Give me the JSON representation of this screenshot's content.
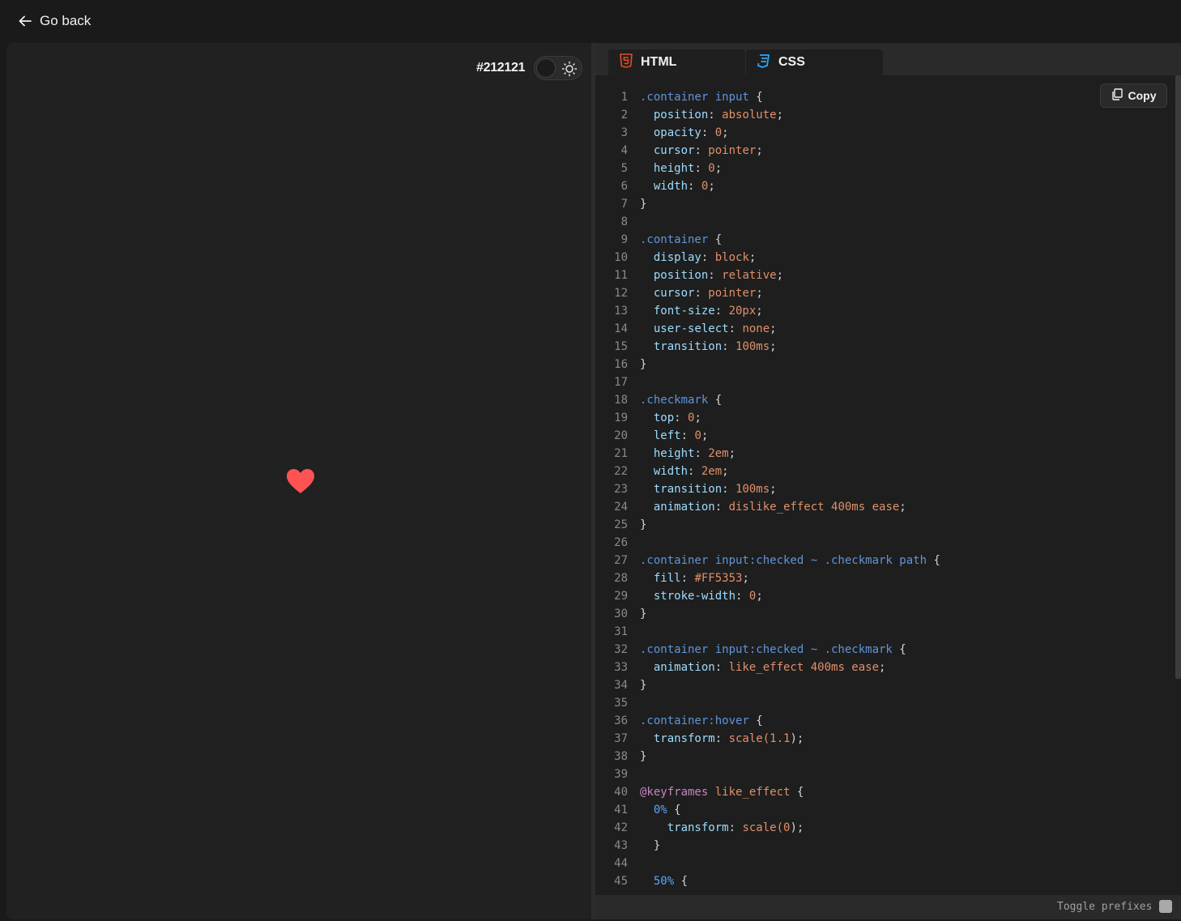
{
  "nav": {
    "back_label": "Go back"
  },
  "preview": {
    "background_hex": "#212121",
    "heart_color": "#FF5353",
    "theme_toggle_icon": "sun-icon"
  },
  "tabs": [
    {
      "label": "HTML",
      "icon": "html5-icon",
      "icon_color": "#e34c26"
    },
    {
      "label": "CSS",
      "icon": "css3-icon",
      "icon_color": "#2aa7ff",
      "active": true
    }
  ],
  "editor": {
    "copy_label": "Copy",
    "toggle_prefixes_label": "Toggle prefixes",
    "code_lines": [
      [
        [
          "sel",
          ".container input"
        ],
        [
          "punc",
          " {"
        ]
      ],
      [
        [
          "punc",
          "  "
        ],
        [
          "prop",
          "position"
        ],
        [
          "punc",
          ": "
        ],
        [
          "val",
          "absolute"
        ],
        [
          "punc",
          ";"
        ]
      ],
      [
        [
          "punc",
          "  "
        ],
        [
          "prop",
          "opacity"
        ],
        [
          "punc",
          ": "
        ],
        [
          "num",
          "0"
        ],
        [
          "punc",
          ";"
        ]
      ],
      [
        [
          "punc",
          "  "
        ],
        [
          "prop",
          "cursor"
        ],
        [
          "punc",
          ": "
        ],
        [
          "val",
          "pointer"
        ],
        [
          "punc",
          ";"
        ]
      ],
      [
        [
          "punc",
          "  "
        ],
        [
          "prop",
          "height"
        ],
        [
          "punc",
          ": "
        ],
        [
          "num",
          "0"
        ],
        [
          "punc",
          ";"
        ]
      ],
      [
        [
          "punc",
          "  "
        ],
        [
          "prop",
          "width"
        ],
        [
          "punc",
          ": "
        ],
        [
          "num",
          "0"
        ],
        [
          "punc",
          ";"
        ]
      ],
      [
        [
          "punc",
          "}"
        ]
      ],
      [],
      [
        [
          "sel",
          ".container"
        ],
        [
          "punc",
          " {"
        ]
      ],
      [
        [
          "punc",
          "  "
        ],
        [
          "prop",
          "display"
        ],
        [
          "punc",
          ": "
        ],
        [
          "val",
          "block"
        ],
        [
          "punc",
          ";"
        ]
      ],
      [
        [
          "punc",
          "  "
        ],
        [
          "prop",
          "position"
        ],
        [
          "punc",
          ": "
        ],
        [
          "val",
          "relative"
        ],
        [
          "punc",
          ";"
        ]
      ],
      [
        [
          "punc",
          "  "
        ],
        [
          "prop",
          "cursor"
        ],
        [
          "punc",
          ": "
        ],
        [
          "val",
          "pointer"
        ],
        [
          "punc",
          ";"
        ]
      ],
      [
        [
          "punc",
          "  "
        ],
        [
          "prop",
          "font-size"
        ],
        [
          "punc",
          ": "
        ],
        [
          "num",
          "20px"
        ],
        [
          "punc",
          ";"
        ]
      ],
      [
        [
          "punc",
          "  "
        ],
        [
          "prop",
          "user-select"
        ],
        [
          "punc",
          ": "
        ],
        [
          "val",
          "none"
        ],
        [
          "punc",
          ";"
        ]
      ],
      [
        [
          "punc",
          "  "
        ],
        [
          "prop",
          "transition"
        ],
        [
          "punc",
          ": "
        ],
        [
          "num",
          "100ms"
        ],
        [
          "punc",
          ";"
        ]
      ],
      [
        [
          "punc",
          "}"
        ]
      ],
      [],
      [
        [
          "sel",
          ".checkmark"
        ],
        [
          "punc",
          " {"
        ]
      ],
      [
        [
          "punc",
          "  "
        ],
        [
          "prop",
          "top"
        ],
        [
          "punc",
          ": "
        ],
        [
          "num",
          "0"
        ],
        [
          "punc",
          ";"
        ]
      ],
      [
        [
          "punc",
          "  "
        ],
        [
          "prop",
          "left"
        ],
        [
          "punc",
          ": "
        ],
        [
          "num",
          "0"
        ],
        [
          "punc",
          ";"
        ]
      ],
      [
        [
          "punc",
          "  "
        ],
        [
          "prop",
          "height"
        ],
        [
          "punc",
          ": "
        ],
        [
          "num",
          "2em"
        ],
        [
          "punc",
          ";"
        ]
      ],
      [
        [
          "punc",
          "  "
        ],
        [
          "prop",
          "width"
        ],
        [
          "punc",
          ": "
        ],
        [
          "num",
          "2em"
        ],
        [
          "punc",
          ";"
        ]
      ],
      [
        [
          "punc",
          "  "
        ],
        [
          "prop",
          "transition"
        ],
        [
          "punc",
          ": "
        ],
        [
          "num",
          "100ms"
        ],
        [
          "punc",
          ";"
        ]
      ],
      [
        [
          "punc",
          "  "
        ],
        [
          "prop",
          "animation"
        ],
        [
          "punc",
          ": "
        ],
        [
          "val",
          "dislike_effect 400ms ease"
        ],
        [
          "punc",
          ";"
        ]
      ],
      [
        [
          "punc",
          "}"
        ]
      ],
      [],
      [
        [
          "sel",
          ".container input:checked ~ .checkmark path"
        ],
        [
          "punc",
          " {"
        ]
      ],
      [
        [
          "punc",
          "  "
        ],
        [
          "prop",
          "fill"
        ],
        [
          "punc",
          ": "
        ],
        [
          "val",
          "#FF5353"
        ],
        [
          "punc",
          ";"
        ]
      ],
      [
        [
          "punc",
          "  "
        ],
        [
          "prop",
          "stroke-width"
        ],
        [
          "punc",
          ": "
        ],
        [
          "num",
          "0"
        ],
        [
          "punc",
          ";"
        ]
      ],
      [
        [
          "punc",
          "}"
        ]
      ],
      [],
      [
        [
          "sel",
          ".container input:checked ~ .checkmark"
        ],
        [
          "punc",
          " {"
        ]
      ],
      [
        [
          "punc",
          "  "
        ],
        [
          "prop",
          "animation"
        ],
        [
          "punc",
          ": "
        ],
        [
          "val",
          "like_effect 400ms ease"
        ],
        [
          "punc",
          ";"
        ]
      ],
      [
        [
          "punc",
          "}"
        ]
      ],
      [],
      [
        [
          "sel",
          ".container:hover"
        ],
        [
          "punc",
          " {"
        ]
      ],
      [
        [
          "punc",
          "  "
        ],
        [
          "prop",
          "transform"
        ],
        [
          "punc",
          ": "
        ],
        [
          "val",
          "scale("
        ],
        [
          "num",
          "1.1"
        ],
        [
          "punc",
          ");"
        ]
      ],
      [
        [
          "punc",
          "}"
        ]
      ],
      [],
      [
        [
          "at",
          "@keyframes"
        ],
        [
          "val",
          " like_effect"
        ],
        [
          "punc",
          " {"
        ]
      ],
      [
        [
          "punc",
          "  "
        ],
        [
          "pct",
          "0%"
        ],
        [
          "punc",
          " {"
        ]
      ],
      [
        [
          "punc",
          "    "
        ],
        [
          "prop",
          "transform"
        ],
        [
          "punc",
          ": "
        ],
        [
          "val",
          "scale("
        ],
        [
          "num",
          "0"
        ],
        [
          "punc",
          ");"
        ]
      ],
      [
        [
          "punc",
          "  }"
        ]
      ],
      [],
      [
        [
          "punc",
          "  "
        ],
        [
          "pct",
          "50%"
        ],
        [
          "punc",
          " {"
        ]
      ]
    ]
  }
}
